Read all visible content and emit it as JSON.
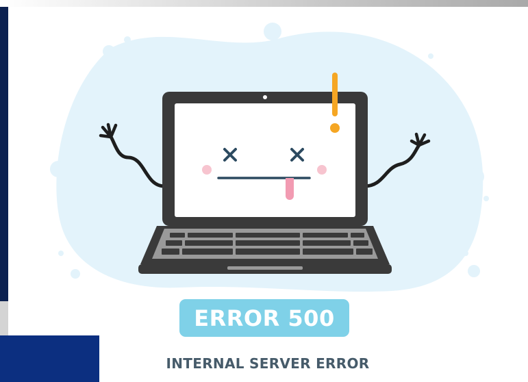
{
  "error": {
    "code": "ERROR 500",
    "subtitle": "INTERNAL SERVER ERROR"
  },
  "colors": {
    "background_blob": "#e3f3fb",
    "pill": "#7fd1e8",
    "laptop_body": "#3a3a3a",
    "screen": "#ffffff",
    "exclamation": "#f5a623",
    "face": "#2c4a60",
    "cheeks": "#f7c4cf",
    "tongue": "#f29bb2",
    "subtitle_text": "#465b6a"
  },
  "icons": {
    "laptop": "laptop-illustration",
    "exclamation": "exclamation-mark-icon"
  }
}
